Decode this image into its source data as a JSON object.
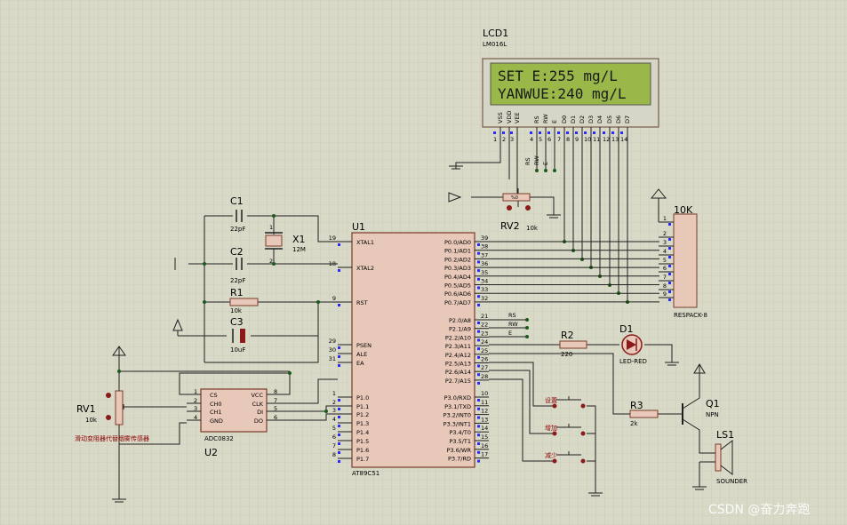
{
  "lcd": {
    "ref": "LCD1",
    "part": "LM016L",
    "line1": "SET  E:255 mg/L",
    "line2": "YANWUE:240 mg/L",
    "pins": [
      "VSS",
      "VDD",
      "VEE",
      "RS",
      "RW",
      "E",
      "D0",
      "D1",
      "D2",
      "D3",
      "D4",
      "D5",
      "D6",
      "D7"
    ],
    "pinnums": [
      "1",
      "2",
      "3",
      "4",
      "5",
      "6",
      "7",
      "8",
      "9",
      "10",
      "11",
      "12",
      "13",
      "14"
    ]
  },
  "u1": {
    "ref": "U1",
    "part": "AT89C51",
    "left_pins": [
      [
        "19",
        "XTAL1"
      ],
      [
        "18",
        "XTAL2"
      ],
      [
        "9",
        "RST"
      ],
      [
        "29",
        "PSEN"
      ],
      [
        "30",
        "ALE"
      ],
      [
        "31",
        "EA"
      ],
      [
        "1",
        "P1.0"
      ],
      [
        "2",
        "P1.1"
      ],
      [
        "3",
        "P1.2"
      ],
      [
        "4",
        "P1.3"
      ],
      [
        "5",
        "P1.4"
      ],
      [
        "6",
        "P1.5"
      ],
      [
        "7",
        "P1.6"
      ],
      [
        "8",
        "P1.7"
      ]
    ],
    "p0": [
      [
        "39",
        "P0.0/AD0"
      ],
      [
        "38",
        "P0.1/AD1"
      ],
      [
        "37",
        "P0.2/AD2"
      ],
      [
        "36",
        "P0.3/AD3"
      ],
      [
        "35",
        "P0.4/AD4"
      ],
      [
        "34",
        "P0.5/AD5"
      ],
      [
        "33",
        "P0.6/AD6"
      ],
      [
        "32",
        "P0.7/AD7"
      ]
    ],
    "p2": [
      [
        "21",
        "P2.0/A8"
      ],
      [
        "22",
        "P2.1/A9"
      ],
      [
        "23",
        "P2.2/A10"
      ],
      [
        "24",
        "P2.3/A11"
      ],
      [
        "25",
        "P2.4/A12"
      ],
      [
        "26",
        "P2.5/A13"
      ],
      [
        "27",
        "P2.6/A14"
      ],
      [
        "28",
        "P2.7/A15"
      ]
    ],
    "p3": [
      [
        "10",
        "P3.0/RXD"
      ],
      [
        "11",
        "P3.1/TXD"
      ],
      [
        "12",
        "P3.2/INT0"
      ],
      [
        "13",
        "P3.3/INT1"
      ],
      [
        "14",
        "P3.4/T0"
      ],
      [
        "15",
        "P3.5/T1"
      ],
      [
        "16",
        "P3.6/WR"
      ],
      [
        "17",
        "P3.7/RD"
      ]
    ]
  },
  "u2": {
    "ref": "U2",
    "part": "ADC0832",
    "left": [
      [
        "1",
        "CS"
      ],
      [
        "2",
        "CH0"
      ],
      [
        "3",
        "CH1"
      ],
      [
        "4",
        "GND"
      ]
    ],
    "right": [
      [
        "8",
        "VCC"
      ],
      [
        "7",
        "CLK"
      ],
      [
        "5",
        "DI"
      ],
      [
        "6",
        "DO"
      ]
    ]
  },
  "c1": {
    "ref": "C1",
    "value": "22pF"
  },
  "c2": {
    "ref": "C2",
    "value": "22pF"
  },
  "c3": {
    "ref": "C3",
    "value": "10uF"
  },
  "r1": {
    "ref": "R1",
    "value": "10k"
  },
  "r2": {
    "ref": "R2",
    "value": "220"
  },
  "r3": {
    "ref": "R3",
    "value": "2k"
  },
  "x1": {
    "ref": "X1",
    "value": "12M",
    "pin1": "1",
    "pin2": "2"
  },
  "rv1": {
    "ref": "RV1",
    "value": "10k",
    "note": "滑动变阻器代替烟雾传感器"
  },
  "rv2": {
    "ref": "RV2",
    "value": "10k",
    "tag": "%0"
  },
  "respack": {
    "ref": "10K",
    "part": "RESPACK-8",
    "pins": [
      "1",
      "2",
      "3",
      "4",
      "5",
      "6",
      "7",
      "8",
      "9"
    ]
  },
  "d1": {
    "ref": "D1",
    "part": "LED-RED"
  },
  "q1": {
    "ref": "Q1",
    "part": "NPN"
  },
  "ls1": {
    "ref": "LS1",
    "part": "SOUNDER"
  },
  "nets": {
    "rs": "RS",
    "rw": "RW",
    "e": "E"
  },
  "buttons": [
    "设置",
    "增加",
    "减少"
  ],
  "watermark": "CSDN @奋力奔跑"
}
